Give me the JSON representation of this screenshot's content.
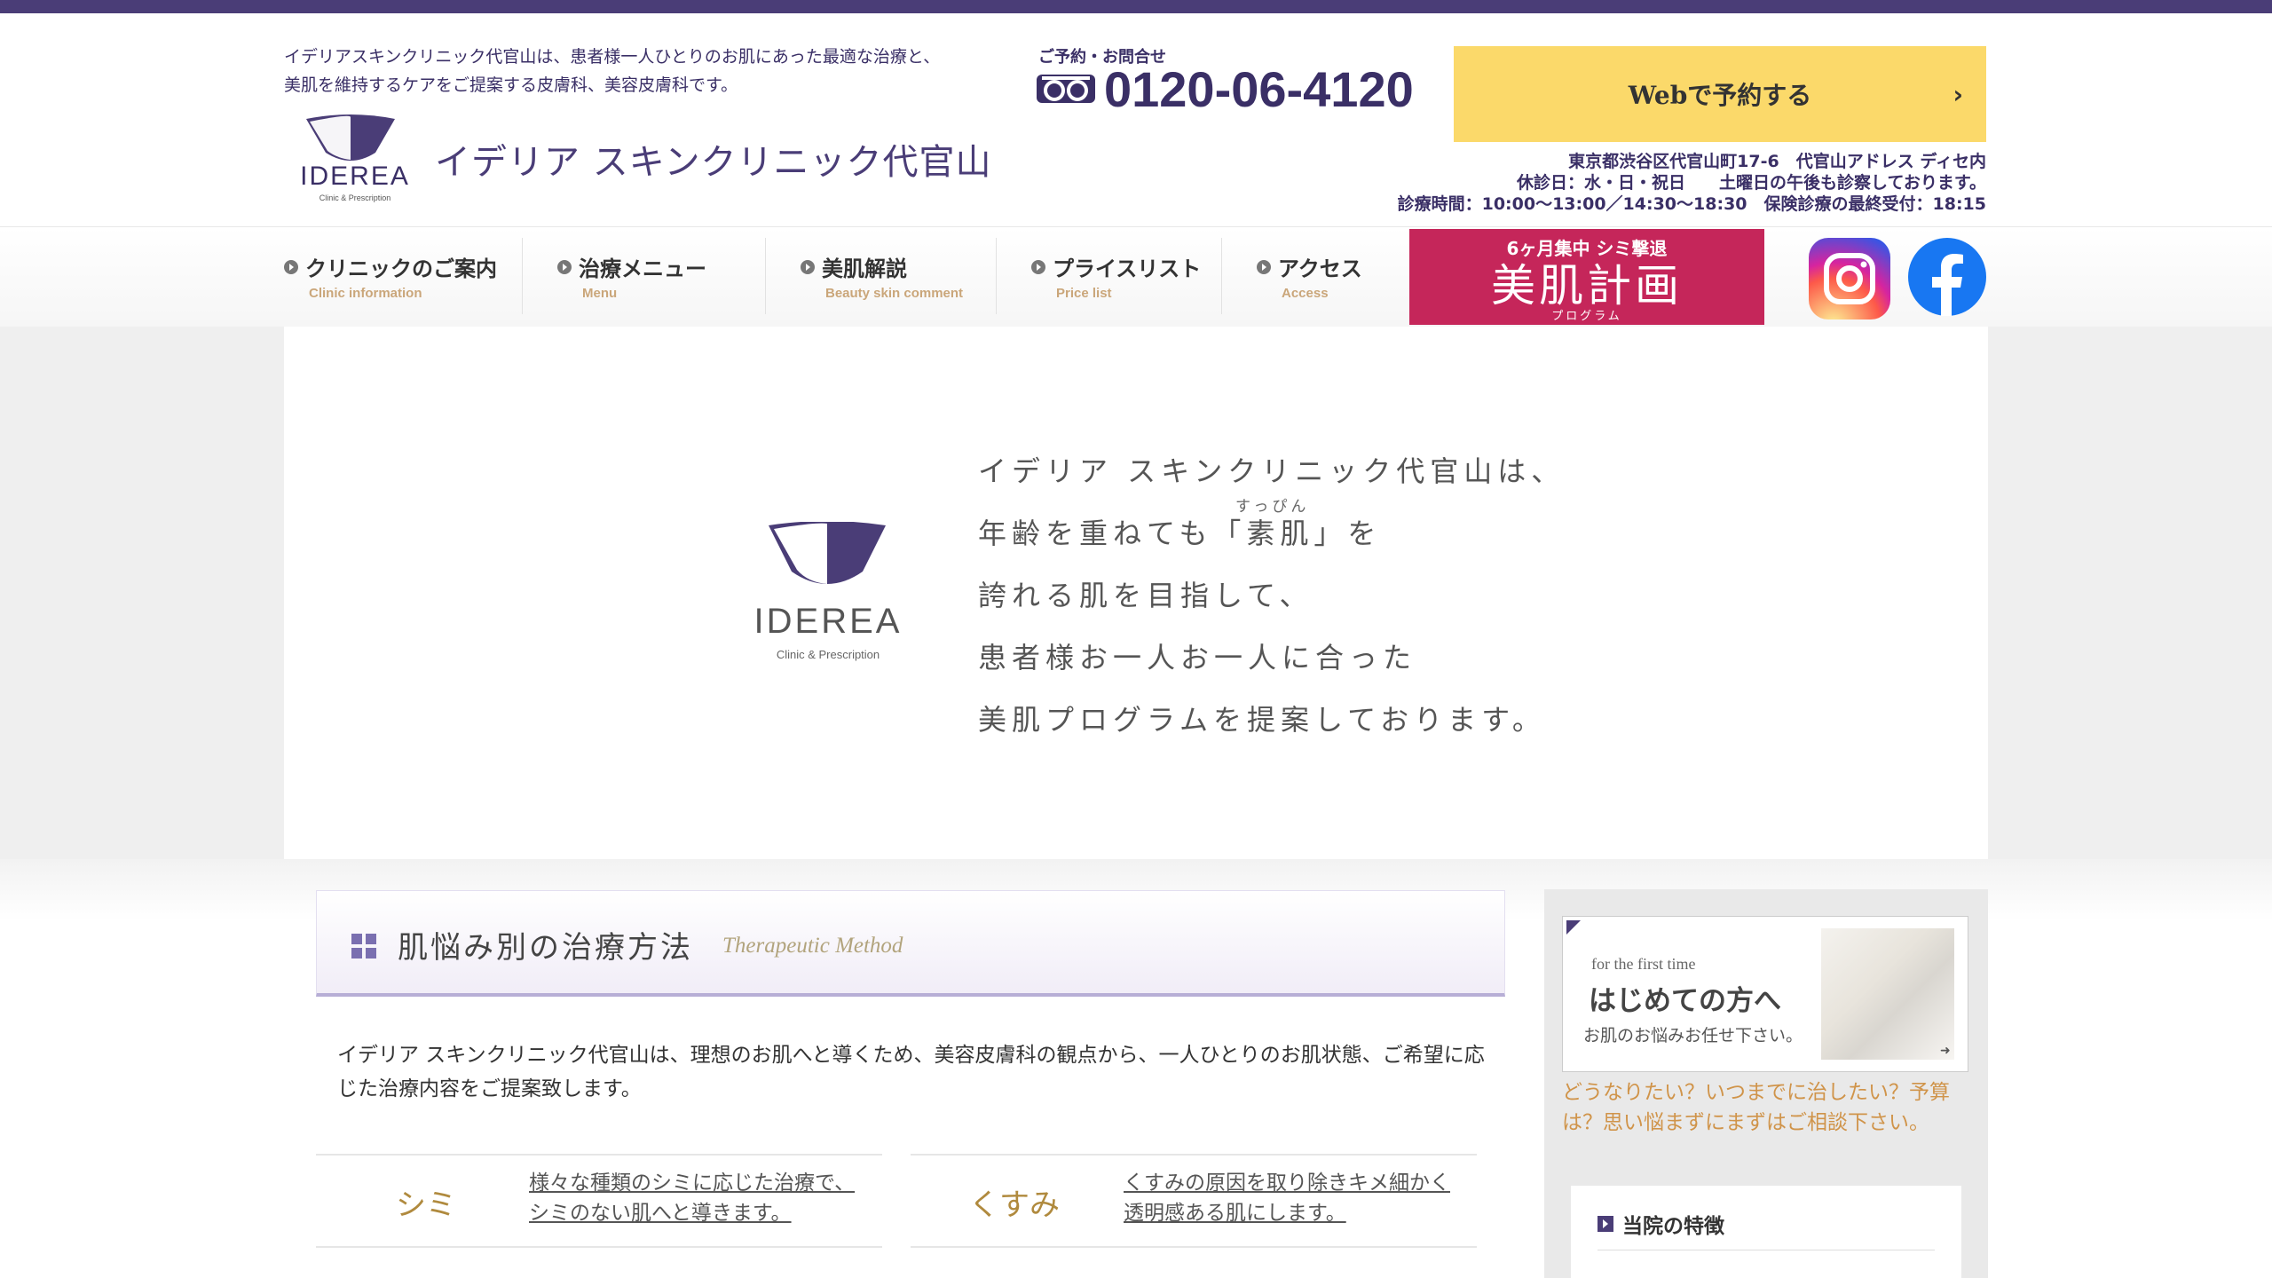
{
  "colors": {
    "brand": "#4a3d77",
    "accent_yellow": "#fbd96a",
    "accent_pink": "#c5265a",
    "gold": "#b08a3e",
    "orange_text": "#d0944a"
  },
  "header": {
    "tagline_1": "イデリアスキンクリニック代官山は、患者様一人ひとりのお肌にあった最適な治療と、",
    "tagline_2": "美肌を維持するケアをご提案する皮膚科、美容皮膚科です。",
    "logo_text": "IDEREA",
    "logo_sub": "Clinic & Prescription",
    "clinic_name": "イデリア スキンクリニック代官山",
    "tel_label": "ご予約・お問合せ",
    "tel_icon": "freedial-icon",
    "tel_number": "0120-06-4120",
    "web_button": "Webで予約する",
    "address": "東京都渋谷区代官山町17-6　代官山アドレス ディセ内",
    "closed_days": "休診日：水・日・祝日　　土曜日の午後も診察しております。",
    "hours": "診療時間：10:00～13:00／14:30～18:30　保険診療の最終受付：18:15"
  },
  "nav": {
    "items": [
      {
        "label": "クリニックのご案内",
        "en": "Clinic information"
      },
      {
        "label": "治療メニュー",
        "en": "Menu"
      },
      {
        "label": "美肌解説",
        "en": "Beauty skin comment"
      },
      {
        "label": "プライスリスト",
        "en": "Price list"
      },
      {
        "label": "アクセス",
        "en": "Access"
      }
    ],
    "banner": {
      "line1": "6ヶ月集中 シミ撃退",
      "line2": "美肌計画",
      "line3": "プログラム"
    },
    "social": [
      "instagram-icon",
      "facebook-icon"
    ]
  },
  "hero": {
    "logo_text": "IDEREA",
    "logo_sub": "Clinic & Prescription",
    "ruby": "すっぴん",
    "lines": [
      "イデリア スキンクリニック代官山は、",
      "年齢を重ねても「素肌」を",
      "誇れる肌を目指して、",
      "患者様お一人お一人に合った",
      "美肌プログラムを提案しております。"
    ]
  },
  "section": {
    "title": "肌悩み別の治療方法",
    "title_en": "Therapeutic Method",
    "intro": "イデリア スキンクリニック代官山は、理想のお肌へと導くため、美容皮膚科の観点から、一人ひとりのお肌状態、ご希望に応じた治療内容をご提案致します。",
    "categories": [
      {
        "name": "シミ",
        "desc_1": "様々な種類のシミに応じた治療で、",
        "desc_2": "シミのない肌へと導きます。"
      },
      {
        "name": "くすみ",
        "desc_1": "くすみの原因を取り除きキメ細かく",
        "desc_2": "透明感ある肌にします。"
      }
    ]
  },
  "sidebar": {
    "first_en": "for the first time",
    "first_ja": "はじめての方へ",
    "first_sub": "お肌のお悩みお任せ下さい。",
    "consult_text": "どうなりたい？いつまでに治したい？予算は？思い悩まずにまずはご相談下さい。",
    "feature_title": "当院の特徴"
  }
}
